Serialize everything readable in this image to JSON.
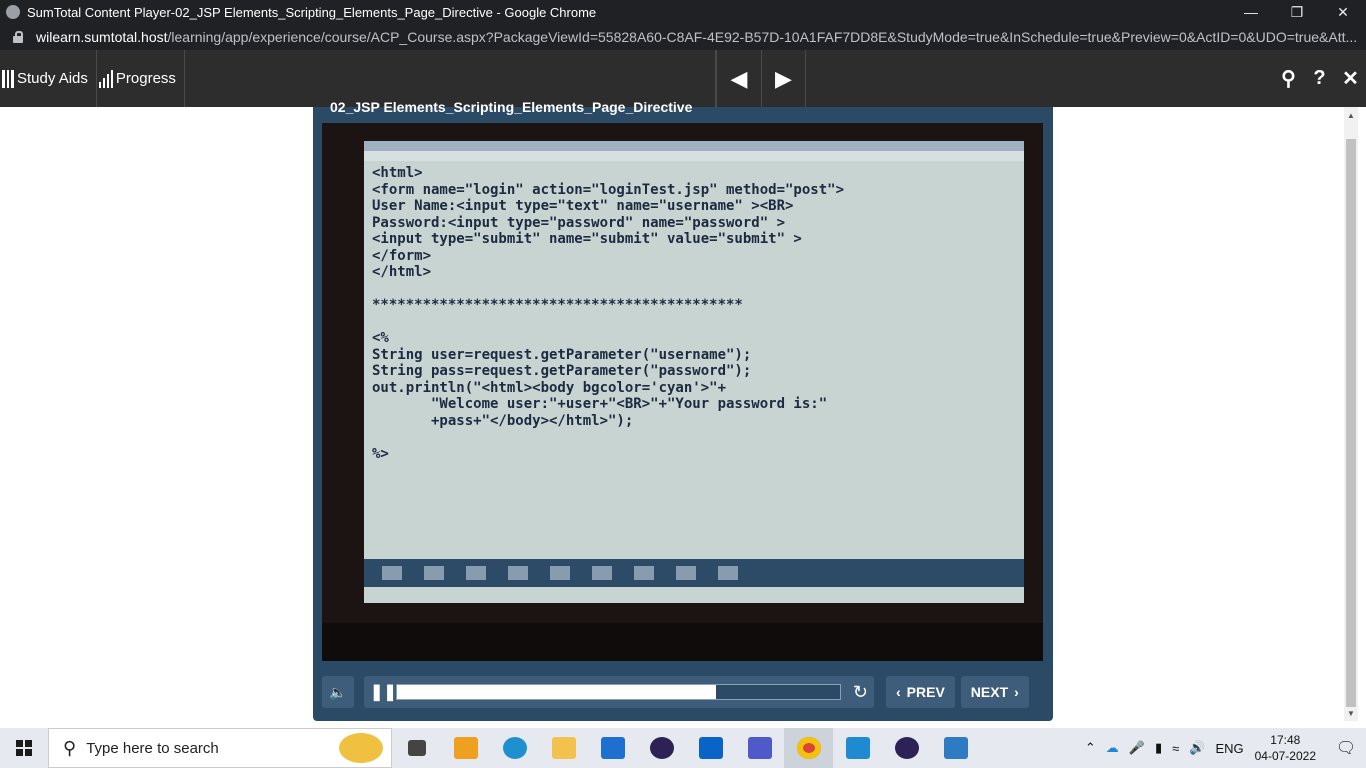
{
  "window": {
    "title": "SumTotal Content Player-02_JSP Elements_Scripting_Elements_Page_Directive - Google Chrome",
    "minimize_icon": "minimize-icon",
    "restore_icon": "restore-icon",
    "close_icon": "close-icon"
  },
  "address": {
    "host": "wilearn.sumtotal.host",
    "path": "/learning/app/experience/course/ACP_Course.aspx?PackageViewId=55828A60-C8AF-4E92-B57D-10A1FAF7DD8E&StudyMode=true&InSchedule=true&Preview=0&ActID=0&UDO=true&Att..."
  },
  "player_bar": {
    "study_aids": "Study Aids",
    "progress": "Progress",
    "prev_icon": "triangle-left-icon",
    "next_icon": "triangle-right-icon",
    "search_icon": "search-icon",
    "help": "?",
    "close": "✕"
  },
  "player": {
    "title": "02_JSP Elements_Scripting_Elements_Page_Directive",
    "video_code": "<html>\n<form name=\"login\" action=\"loginTest.jsp\" method=\"post\">\nUser Name:<input type=\"text\" name=\"username\" ><BR>\nPassword:<input type=\"password\" name=\"password\" >\n<input type=\"submit\" name=\"submit\" value=\"submit\" >\n</form>\n</html>\n\n********************************************\n\n<%\nString user=request.getParameter(\"username\");\nString pass=request.getParameter(\"password\");\nout.println(\"<html><body bgcolor='cyan'>\"+\n       \"Welcome user:\"+user+\"<BR>\"+\"Your password is:\"\n       +pass+\"</body></html>\");\n\n%>",
    "progress_fraction": 0.72,
    "prev_label": "PREV",
    "next_label": "NEXT"
  },
  "taskbar": {
    "search_placeholder": "Type here to search",
    "lang": "ENG",
    "time": "17:48",
    "date": "04-07-2022"
  },
  "colors": {
    "player_bg": "#2b4a66",
    "control_bg": "#3e5d7a",
    "bar_bg": "#2d2d2d"
  }
}
